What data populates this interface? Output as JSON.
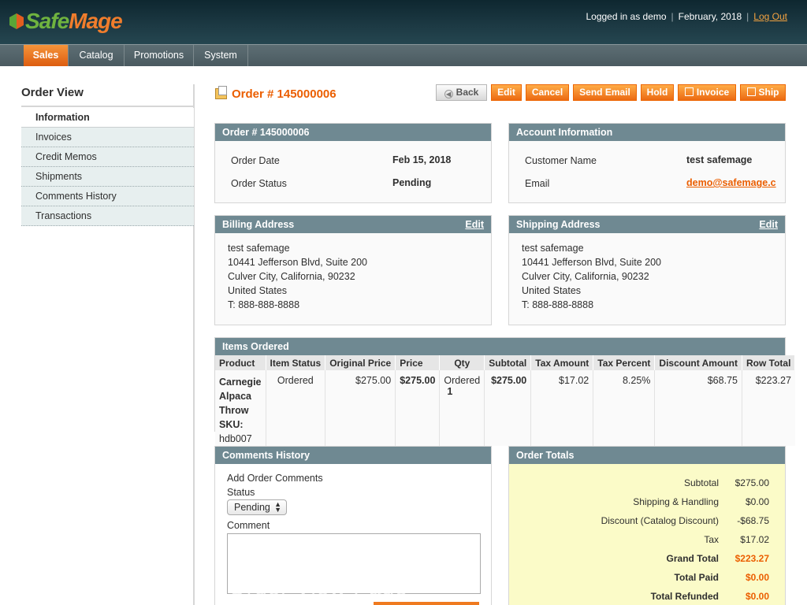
{
  "header": {
    "logo_part1": "Safe",
    "logo_part2": "Mage",
    "logged_in": "Logged in as demo",
    "date": "February, 2018",
    "logout": "Log Out"
  },
  "nav": [
    "Sales",
    "Catalog",
    "Promotions",
    "System"
  ],
  "sidebar": {
    "title": "Order View",
    "items": [
      "Information",
      "Invoices",
      "Credit Memos",
      "Shipments",
      "Comments History",
      "Transactions"
    ]
  },
  "page": {
    "title": "Order # 145000006",
    "buttons": [
      "Back",
      "Edit",
      "Cancel",
      "Send Email",
      "Hold",
      "Invoice",
      "Ship"
    ]
  },
  "order_panel": {
    "title": "Order # 145000006",
    "date_label": "Order Date",
    "date_value": "Feb 15, 2018",
    "status_label": "Order Status",
    "status_value": "Pending"
  },
  "account_panel": {
    "title": "Account Information",
    "name_label": "Customer Name",
    "name_value": "test safemage",
    "email_label": "Email",
    "email_value": "demo@safemage.c"
  },
  "billing": {
    "title": "Billing Address",
    "edit": "Edit",
    "lines": [
      "test safemage",
      "10441 Jefferson Blvd, Suite 200",
      "Culver City, California, 90232",
      "United States",
      "T: 888-888-8888"
    ]
  },
  "shipping": {
    "title": "Shipping Address",
    "edit": "Edit",
    "lines": [
      "test safemage",
      "10441 Jefferson Blvd, Suite 200",
      "Culver City, California, 90232",
      "United States",
      "T: 888-888-8888"
    ]
  },
  "items": {
    "title": "Items Ordered",
    "columns": [
      "Product",
      "Item Status",
      "Original Price",
      "Price",
      "Qty",
      "Subtotal",
      "Tax Amount",
      "Tax Percent",
      "Discount Amount",
      "Row Total"
    ],
    "row": {
      "product_lines": [
        "Carnegie",
        "Alpaca",
        "Throw"
      ],
      "sku_label": "SKU:",
      "sku": "hdb007",
      "status": "Ordered",
      "original_price": "$275.00",
      "price": "$275.00",
      "qty_label": "Ordered",
      "qty": "1",
      "subtotal": "$275.00",
      "tax_amount": "$17.02",
      "tax_percent": "8.25%",
      "discount": "$68.75",
      "row_total": "$223.27"
    }
  },
  "comments": {
    "title": "Comments History",
    "add_label": "Add Order Comments",
    "status_label": "Status",
    "status_value": "Pending",
    "comment_label": "Comment"
  },
  "totals": {
    "title": "Order Totals",
    "rows": [
      {
        "label": "Subtotal",
        "value": "$275.00"
      },
      {
        "label": "Shipping & Handling",
        "value": "$0.00"
      },
      {
        "label": "Discount (Catalog Discount)",
        "value": "-$68.75"
      },
      {
        "label": "Tax",
        "value": "$17.02"
      },
      {
        "label": "Grand Total",
        "value": "$223.27"
      },
      {
        "label": "Total Paid",
        "value": "$0.00"
      },
      {
        "label": "Total Refunded",
        "value": "$0.00"
      }
    ]
  },
  "watermark": "Order View Page"
}
